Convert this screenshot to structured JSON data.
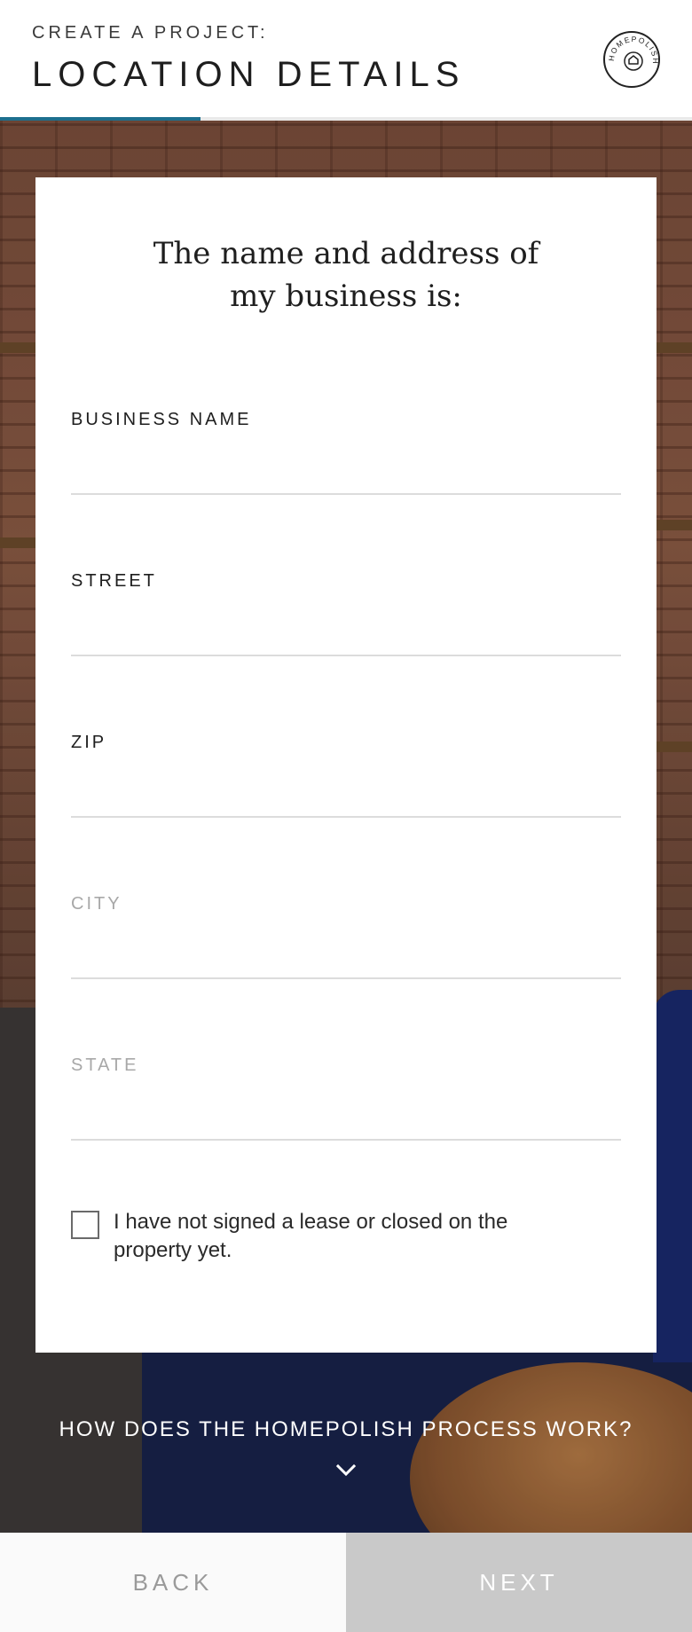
{
  "header": {
    "kicker": "CREATE A PROJECT:",
    "title": "LOCATION DETAILS",
    "logo_text": "HOMEPOLISH",
    "logo_icon": "house-icon",
    "progress_fraction": 0.29,
    "accent_color": "#1d6f8e"
  },
  "card": {
    "heading_line1": "The name and address of",
    "heading_line2": "my business is:",
    "fields": [
      {
        "label": "BUSINESS NAME",
        "value": "",
        "placeholder": ""
      },
      {
        "label": "STREET",
        "value": "",
        "placeholder": ""
      },
      {
        "label": "ZIP",
        "value": "",
        "placeholder": ""
      },
      {
        "label": "CITY",
        "value": "",
        "placeholder": ""
      },
      {
        "label": "STATE",
        "value": "",
        "placeholder": ""
      }
    ],
    "checkbox": {
      "checked": false,
      "label": "I have not signed a lease or closed on the property yet."
    }
  },
  "info": {
    "how_it_works": "HOW DOES THE HOMEPOLISH PROCESS WORK?",
    "icon": "chevron-down-icon"
  },
  "footer": {
    "back_label": "BACK",
    "next_label": "NEXT"
  }
}
